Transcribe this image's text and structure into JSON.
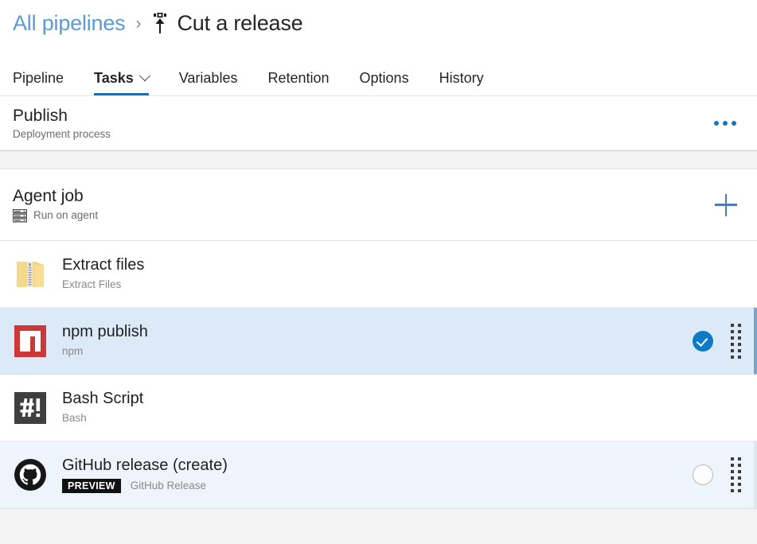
{
  "breadcrumb": {
    "parent_label": "All pipelines",
    "separator": "›",
    "release_icon": "release-icon",
    "current_label": "Cut a release"
  },
  "tabs": [
    {
      "label": "Pipeline",
      "active": false,
      "has_chevron": false
    },
    {
      "label": "Tasks",
      "active": true,
      "has_chevron": true
    },
    {
      "label": "Variables",
      "active": false,
      "has_chevron": false
    },
    {
      "label": "Retention",
      "active": false,
      "has_chevron": false
    },
    {
      "label": "Options",
      "active": false,
      "has_chevron": false
    },
    {
      "label": "History",
      "active": false,
      "has_chevron": false
    }
  ],
  "publish_block": {
    "title": "Publish",
    "subtitle": "Deployment process",
    "more_menu_label": "more-options"
  },
  "agent_block": {
    "title": "Agent job",
    "subtitle": "Run on agent",
    "icon": "server-rack-icon",
    "add_label": "add-task"
  },
  "tasks": [
    {
      "name": "Extract files",
      "subtitle": "Extract Files",
      "icon": "zip-folder-icon",
      "state": "normal",
      "badge": "",
      "enabled_toggle": "none"
    },
    {
      "name": "npm publish",
      "subtitle": "npm",
      "icon": "npm-icon",
      "state": "selected",
      "badge": "",
      "enabled_toggle": "checked"
    },
    {
      "name": "Bash Script",
      "subtitle": "Bash",
      "icon": "bash-icon",
      "state": "normal",
      "badge": "",
      "enabled_toggle": "none"
    },
    {
      "name": "GitHub release (create)",
      "subtitle": "GitHub Release",
      "icon": "github-icon",
      "state": "highlight",
      "badge": "PREVIEW",
      "enabled_toggle": "unchecked"
    }
  ],
  "colors": {
    "accent_blue": "#0078d4",
    "link_blue": "#5b9ad5",
    "selected_row": "#dce9f7",
    "highlight_row": "#eef4fb",
    "npm_red": "#cb3837",
    "bash_dark": "#3f3f3f",
    "zip_yellow": "#f7d881",
    "badge_black": "#111111"
  }
}
